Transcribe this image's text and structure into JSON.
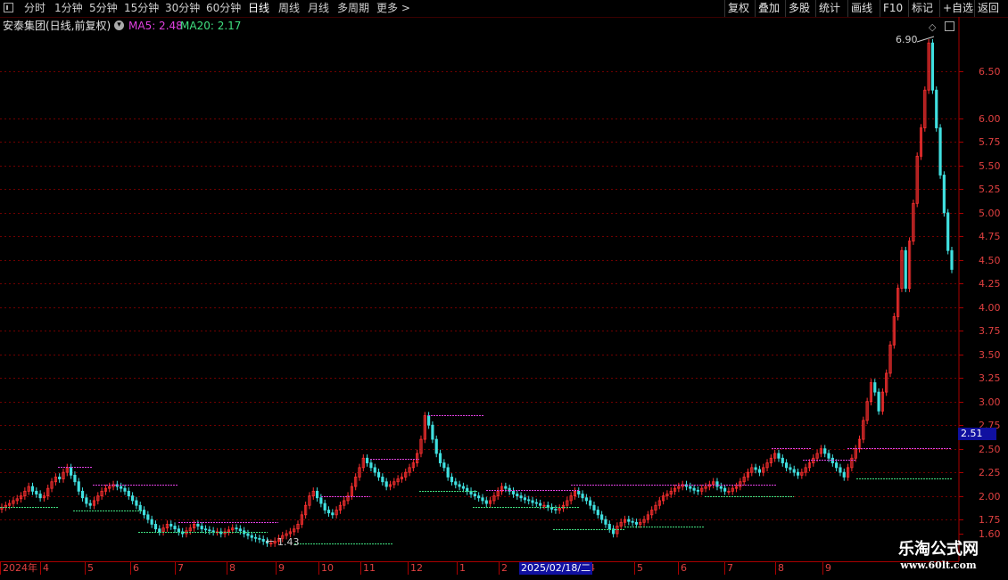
{
  "toolbar": {
    "periods": [
      "分时",
      "1分钟",
      "5分钟",
      "15分钟",
      "30分钟",
      "60分钟",
      "日线",
      "周线",
      "月线",
      "多周期",
      "更多 >"
    ],
    "active_period": "日线",
    "right_buttons": [
      "复权",
      "叠加",
      "多股",
      "统计",
      "画线",
      "F10",
      "标记",
      "+自选",
      "返回"
    ]
  },
  "info": {
    "title": "安泰集团(日线,前复权)",
    "ma5_label": "MA5: 2.48",
    "ma20_label": "MA20: 2.17",
    "ma5_color": "#e040e0",
    "ma20_color": "#40e080"
  },
  "axis": {
    "price_labels": [
      "6.50",
      "6.00",
      "5.75",
      "5.50",
      "5.25",
      "5.00",
      "4.75",
      "4.50",
      "4.25",
      "4.00",
      "3.75",
      "3.50",
      "3.25",
      "3.00",
      "2.75",
      "2.50",
      "2.25",
      "2.00",
      "1.75",
      "1.60"
    ],
    "current_price": "2.51"
  },
  "date_axis": {
    "ticks": [
      "2024年",
      "4",
      "5",
      "6",
      "7",
      "8",
      "9",
      "10",
      "11",
      "12",
      "1",
      "2",
      "3",
      "4",
      "5",
      "6",
      "7",
      "8",
      "9"
    ],
    "cursor_date": "2025/02/18/二"
  },
  "annotations": {
    "high": "6.90",
    "low": "1.43"
  },
  "watermark": {
    "title": "乐淘公式网",
    "url": "www.60lt.com"
  },
  "colors": {
    "up": "#ff3030",
    "down": "#40e0e0",
    "grid": "#700000",
    "axis": "#aa0000"
  },
  "chart_data": {
    "type": "candlestick",
    "title": "安泰集团(日线,前复权)",
    "ylim": [
      1.6,
      7.0
    ],
    "high": 6.9,
    "low": 1.43,
    "current": 2.51,
    "ma5": 2.48,
    "ma20": 2.17,
    "series": [
      {
        "name": "MA5",
        "last": 2.48
      },
      {
        "name": "MA20",
        "last": 2.17
      }
    ],
    "closes": [
      1.88,
      1.9,
      1.92,
      1.95,
      1.97,
      2.0,
      2.05,
      2.1,
      2.05,
      2.02,
      1.98,
      2.0,
      2.08,
      2.15,
      2.2,
      2.18,
      2.25,
      2.3,
      2.22,
      2.15,
      2.05,
      1.98,
      1.92,
      1.9,
      1.95,
      2.0,
      2.05,
      2.08,
      2.1,
      2.12,
      2.1,
      2.08,
      2.05,
      2.0,
      1.95,
      1.9,
      1.85,
      1.8,
      1.75,
      1.7,
      1.65,
      1.62,
      1.66,
      1.7,
      1.68,
      1.65,
      1.62,
      1.6,
      1.63,
      1.66,
      1.7,
      1.68,
      1.65,
      1.64,
      1.63,
      1.62,
      1.62,
      1.6,
      1.62,
      1.64,
      1.66,
      1.65,
      1.63,
      1.6,
      1.58,
      1.56,
      1.55,
      1.54,
      1.52,
      1.5,
      1.5,
      1.52,
      1.55,
      1.58,
      1.6,
      1.62,
      1.65,
      1.7,
      1.8,
      1.9,
      2.0,
      2.05,
      1.98,
      1.92,
      1.85,
      1.82,
      1.8,
      1.85,
      1.9,
      1.95,
      2.0,
      2.1,
      2.2,
      2.3,
      2.4,
      2.35,
      2.3,
      2.25,
      2.2,
      2.15,
      2.1,
      2.12,
      2.15,
      2.18,
      2.2,
      2.25,
      2.3,
      2.35,
      2.45,
      2.6,
      2.85,
      2.75,
      2.6,
      2.45,
      2.35,
      2.3,
      2.2,
      2.15,
      2.12,
      2.1,
      2.08,
      2.05,
      2.02,
      2.0,
      1.98,
      1.95,
      1.92,
      1.95,
      2.0,
      2.05,
      2.1,
      2.08,
      2.05,
      2.02,
      2.0,
      1.98,
      1.96,
      1.95,
      1.93,
      1.92,
      1.9,
      1.9,
      1.88,
      1.86,
      1.85,
      1.87,
      1.9,
      1.95,
      2.0,
      2.05,
      2.02,
      1.98,
      1.95,
      1.9,
      1.85,
      1.8,
      1.75,
      1.7,
      1.65,
      1.6,
      1.68,
      1.72,
      1.75,
      1.73,
      1.72,
      1.7,
      1.72,
      1.75,
      1.8,
      1.85,
      1.9,
      1.95,
      2.0,
      2.02,
      2.05,
      2.08,
      2.1,
      2.12,
      2.1,
      2.08,
      2.06,
      2.05,
      2.08,
      2.1,
      2.12,
      2.15,
      2.1,
      2.08,
      2.05,
      2.05,
      2.08,
      2.1,
      2.15,
      2.2,
      2.25,
      2.3,
      2.28,
      2.25,
      2.3,
      2.35,
      2.4,
      2.45,
      2.4,
      2.35,
      2.3,
      2.28,
      2.25,
      2.22,
      2.25,
      2.3,
      2.35,
      2.4,
      2.45,
      2.5,
      2.45,
      2.4,
      2.35,
      2.3,
      2.25,
      2.2,
      2.3,
      2.4,
      2.5,
      2.6,
      2.8,
      3.0,
      3.2,
      3.1,
      2.9,
      3.1,
      3.3,
      3.6,
      3.9,
      4.2,
      4.6,
      4.2,
      4.7,
      5.1,
      5.6,
      5.9,
      6.3,
      6.8,
      6.3,
      5.9,
      5.4,
      5.0,
      4.6,
      4.4
    ]
  }
}
